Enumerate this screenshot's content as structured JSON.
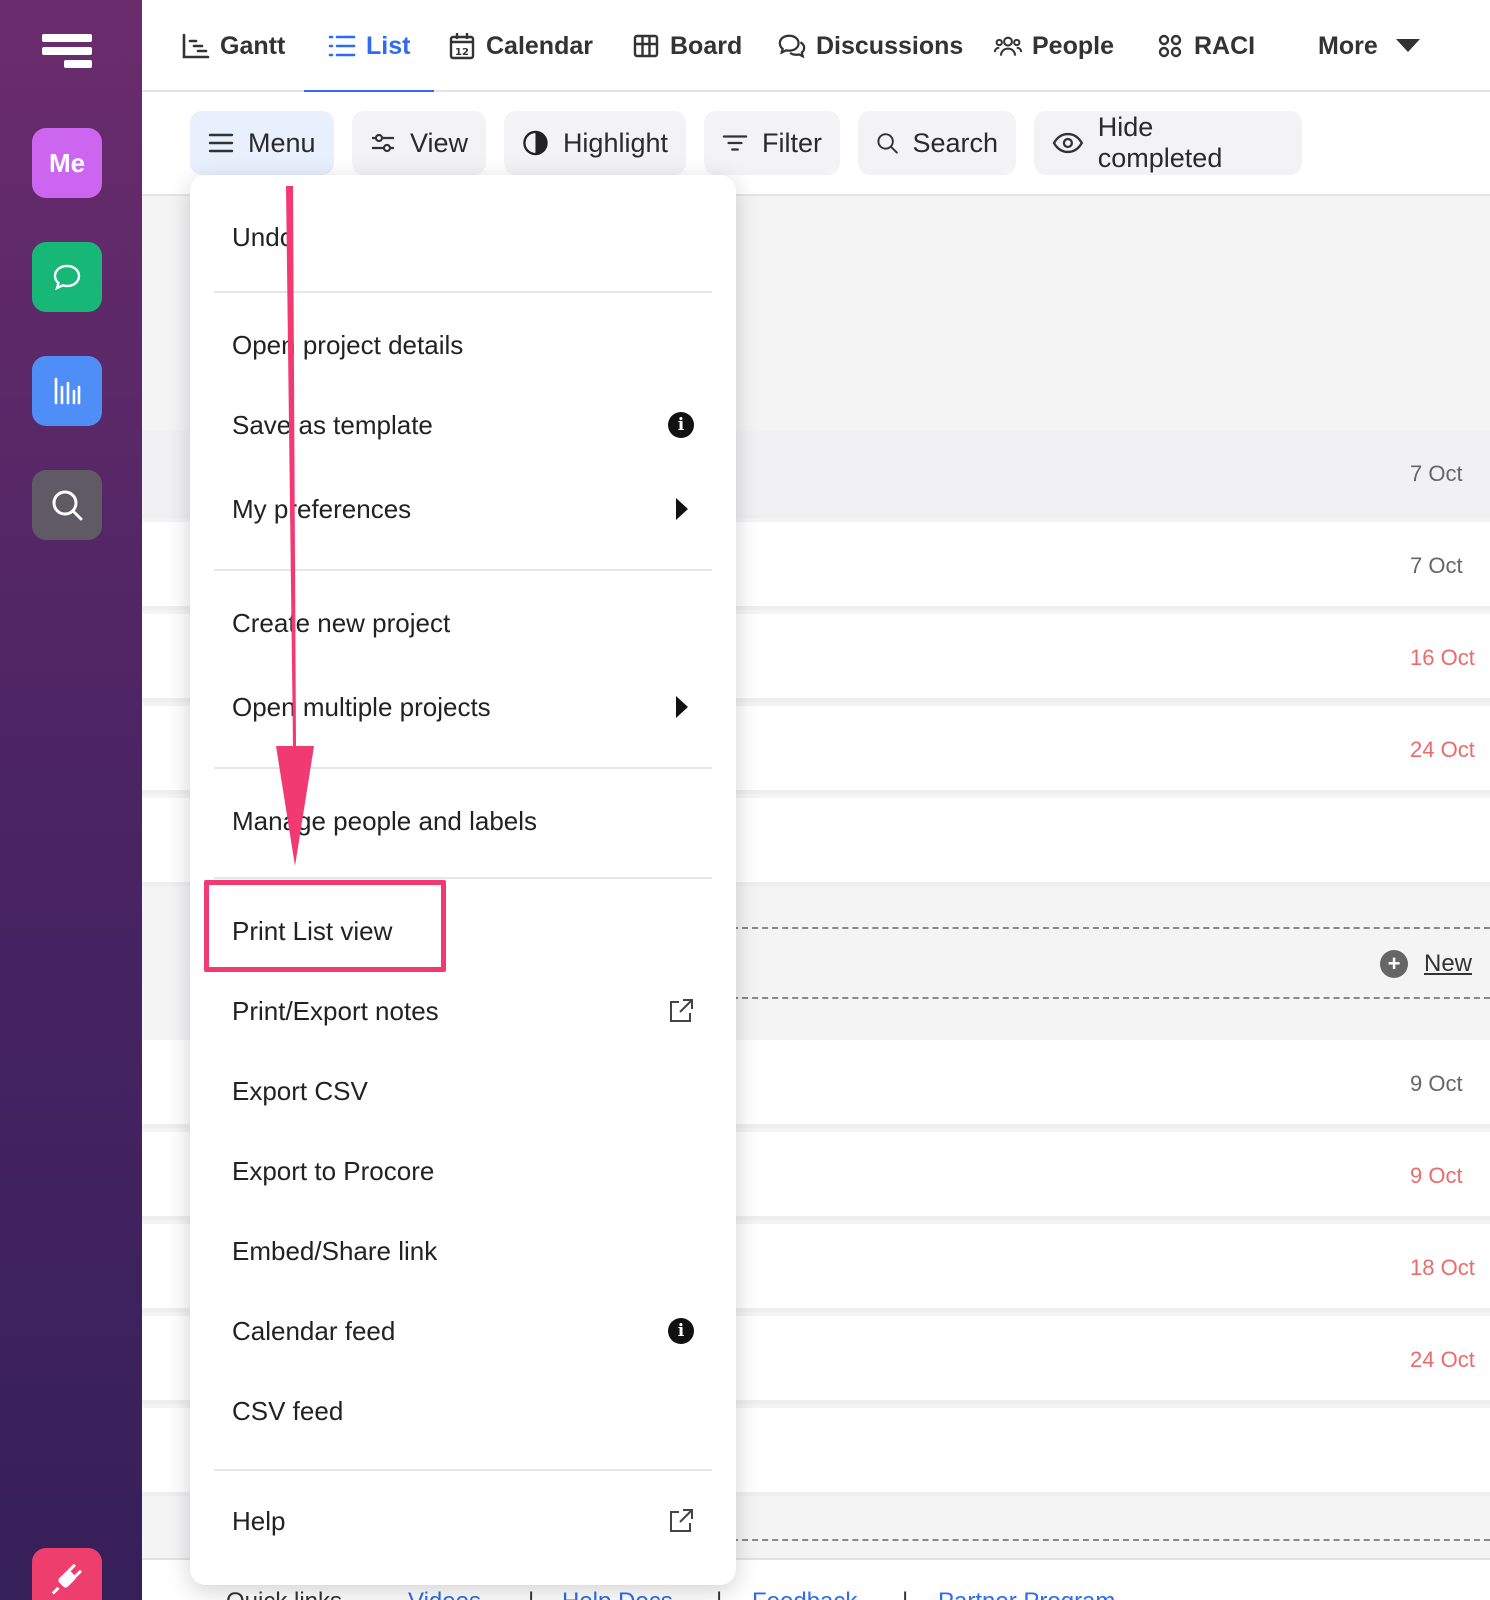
{
  "rail": {
    "me_label": "Me"
  },
  "nav": {
    "items": [
      {
        "label": "Gantt",
        "icon": "gantt-icon"
      },
      {
        "label": "List",
        "icon": "list-icon"
      },
      {
        "label": "Calendar",
        "icon": "calendar-icon"
      },
      {
        "label": "Board",
        "icon": "board-icon"
      },
      {
        "label": "Discussions",
        "icon": "discussions-icon"
      },
      {
        "label": "People",
        "icon": "people-icon"
      },
      {
        "label": "RACI",
        "icon": "raci-icon"
      },
      {
        "label": "More",
        "icon": "caret-down-icon"
      }
    ],
    "active": "List",
    "calendar_day": "12"
  },
  "toolbar": {
    "menu": "Menu",
    "view": "View",
    "highlight": "Highlight",
    "filter": "Filter",
    "search": "Search",
    "hide_completed": "Hide completed"
  },
  "rows": {
    "dates": [
      "7 Oct",
      "7 Oct",
      "16 Oct",
      "24 Oct",
      "9 Oct",
      "9 Oct",
      "18 Oct",
      "24 Oct"
    ],
    "new_label": "New"
  },
  "footer": {
    "quick_links": "Quick links",
    "videos": "Videos",
    "help_docs": "Help Docs",
    "feedback": "Feedback",
    "partner": "Partner Program",
    "sep": "|"
  },
  "menu": {
    "undo": "Undo",
    "open_project_details": "Open project details",
    "save_as_template": "Save as template",
    "my_preferences": "My preferences",
    "create_new_project": "Create new project",
    "open_multiple_projects": "Open multiple projects",
    "manage_people_labels": "Manage people and labels",
    "print_list_view": "Print List view",
    "print_export_notes": "Print/Export notes",
    "export_csv": "Export CSV",
    "export_procore": "Export to Procore",
    "embed_share": "Embed/Share link",
    "calendar_feed": "Calendar feed",
    "csv_feed": "CSV feed",
    "help": "Help",
    "info_glyph": "i"
  },
  "colors": {
    "accent": "#2f6bf0",
    "annotation": "#f23a72",
    "overdue": "#ee6a6a"
  }
}
